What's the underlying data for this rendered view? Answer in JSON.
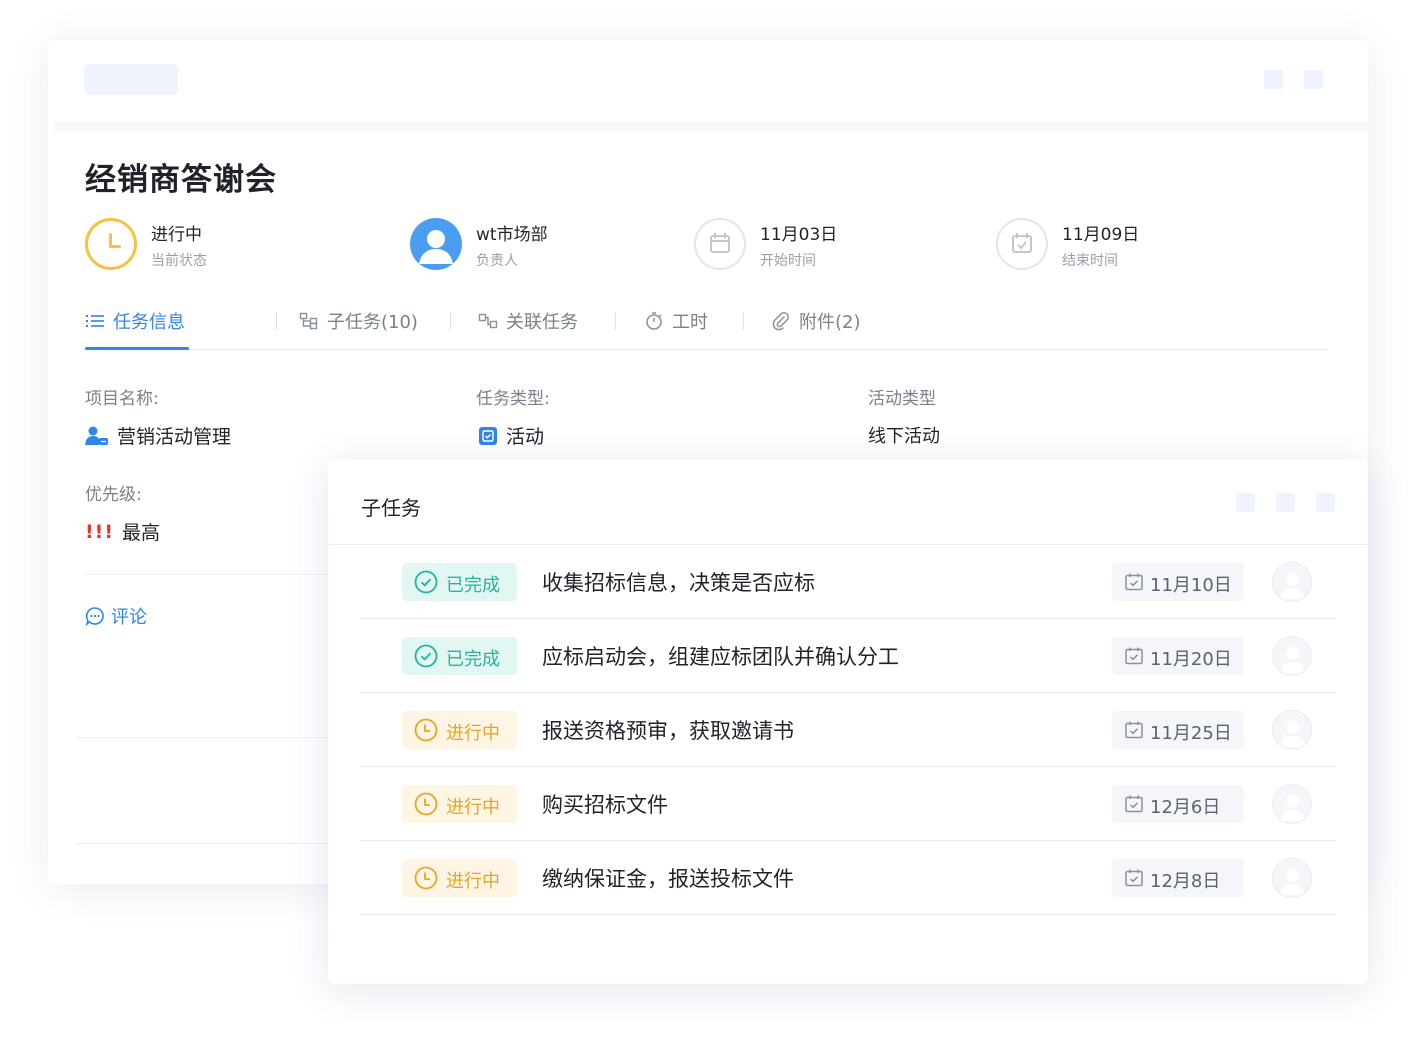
{
  "task": {
    "title": "经销商答谢会",
    "status": {
      "value": "进行中",
      "label": "当前状态"
    },
    "owner": {
      "value": "wt市场部",
      "label": "负责人"
    },
    "start": {
      "value": "11月03日",
      "label": "开始时间"
    },
    "end": {
      "value": "11月09日",
      "label": "结束时间"
    }
  },
  "tabs": [
    {
      "label": "任务信息",
      "icon": "list-icon",
      "active": true
    },
    {
      "label": "子任务(10)",
      "icon": "subtask-icon",
      "active": false
    },
    {
      "label": "关联任务",
      "icon": "link-task-icon",
      "active": false
    },
    {
      "label": "工时",
      "icon": "timer-icon",
      "active": false
    },
    {
      "label": "附件(2)",
      "icon": "paperclip-icon",
      "active": false
    }
  ],
  "fields": {
    "project": {
      "label": "项目名称:",
      "value": "营销活动管理"
    },
    "task_type": {
      "label": "任务类型:",
      "value": "活动"
    },
    "activity_type": {
      "label": "活动类型",
      "value": "线下活动"
    },
    "priority": {
      "label": "优先级:",
      "mark": "!!!",
      "value": "最高"
    }
  },
  "comment_label": "评论",
  "subtasks": {
    "title": "子任务",
    "rows": [
      {
        "status": "已完成",
        "state": "done",
        "name": "收集招标信息，决策是否应标",
        "due": "11月10日"
      },
      {
        "status": "已完成",
        "state": "done",
        "name": "应标启动会，组建应标团队并确认分工",
        "due": "11月20日"
      },
      {
        "status": "进行中",
        "state": "progress",
        "name": "报送资格预审，获取邀请书",
        "due": "11月25日"
      },
      {
        "status": "进行中",
        "state": "progress",
        "name": "购买招标文件",
        "due": "12月6日"
      },
      {
        "status": "进行中",
        "state": "progress",
        "name": "缴纳保证金，报送投标文件",
        "due": "12月8日"
      }
    ]
  },
  "colors": {
    "accent": "#2f86e8",
    "done": "#26b49a",
    "progress": "#e8a523",
    "priority": "#e6362b"
  }
}
